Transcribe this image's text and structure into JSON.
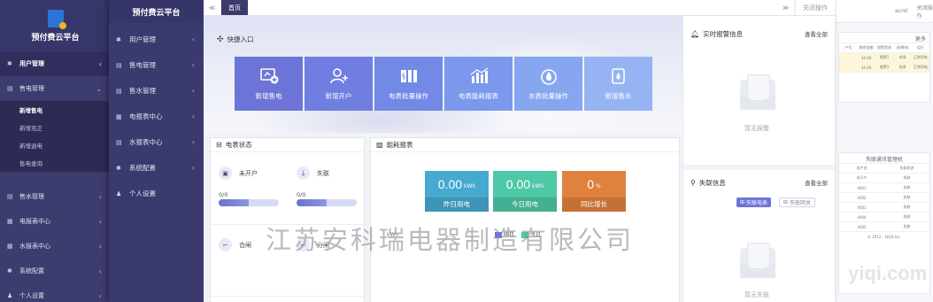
{
  "background_left": {
    "title": "预付费云平台",
    "items": [
      {
        "icon": "gear-icon",
        "label": "用户管理",
        "active": true
      },
      {
        "icon": "list-icon",
        "label": "售电管理"
      },
      {
        "icon": "list-icon",
        "label": "售水管理"
      },
      {
        "icon": "grid-icon",
        "label": "电报表中心"
      },
      {
        "icon": "grid-icon",
        "label": "水报表中心"
      },
      {
        "icon": "gear-icon",
        "label": "系统配置"
      },
      {
        "icon": "user-icon",
        "label": "个人设置"
      }
    ],
    "sub_items": [
      "新增售电",
      "新增充正",
      "新增退电",
      "售电查询"
    ]
  },
  "app": {
    "title": "预付费云平台",
    "nav": [
      {
        "icon": "gear-icon",
        "label": "用户管理"
      },
      {
        "icon": "list-icon",
        "label": "售电管理"
      },
      {
        "icon": "list-icon",
        "label": "售水管理"
      },
      {
        "icon": "grid-icon",
        "label": "电报表中心"
      },
      {
        "icon": "list-icon",
        "label": "水报表中心"
      },
      {
        "icon": "gear-icon",
        "label": "系统配置"
      },
      {
        "icon": "user-icon",
        "label": "个人设置"
      }
    ]
  },
  "tabbar": {
    "back": "≪",
    "tab_home": "首页",
    "forward": "≫",
    "close_ops": "关闭操作"
  },
  "quick_entry": {
    "title": "快捷入口",
    "tiles": [
      {
        "label": "新增售电",
        "icon": "monitor-plus-icon",
        "color": "#6d74d8"
      },
      {
        "label": "新增开户",
        "icon": "user-add-icon",
        "color": "#6f7ee0"
      },
      {
        "label": "电表批量操作",
        "icon": "meter-batch-icon",
        "color": "#7289e6"
      },
      {
        "label": "电表能耗报表",
        "icon": "chart-icon",
        "color": "#7b98ec"
      },
      {
        "label": "水表批量操作",
        "icon": "water-drop-icon",
        "color": "#86a6f0"
      },
      {
        "label": "新增售水",
        "icon": "water-tap-icon",
        "color": "#96b4f4"
      }
    ]
  },
  "meter_status": {
    "title": "电表状态",
    "cells": [
      {
        "icon": "meter-icon",
        "label": "未开户",
        "value": "0/0",
        "progress": 0.5
      },
      {
        "icon": "plug-icon",
        "label": "失联",
        "value": "0/0",
        "progress": 0.5
      },
      {
        "icon": "switch-icon",
        "label": "合闸",
        "value": "",
        "progress": 0
      },
      {
        "icon": "switch-icon",
        "label": "分闸",
        "value": "",
        "progress": 0
      }
    ]
  },
  "energy_report": {
    "title": "能耗报表",
    "kpis": [
      {
        "value": "0.00",
        "unit": "kWh",
        "label": "昨日用电",
        "color": "#46a9cf"
      },
      {
        "value": "0.00",
        "unit": "kWh",
        "label": "今日用电",
        "color": "#4ec8a7"
      },
      {
        "value": "0",
        "unit": "%",
        "label": "同比增长",
        "color": "#e0813e"
      }
    ],
    "unit_label": "kWh",
    "legend": [
      {
        "label": "昨日",
        "color": "#6d74d8"
      },
      {
        "label": "今日",
        "color": "#4ec8a7"
      }
    ]
  },
  "alarms": {
    "title": "实时报警信息",
    "view_all": "查看全部",
    "empty": "暂无报警"
  },
  "offline": {
    "title": "失联信息",
    "view_all": "查看全部",
    "btn_meter": "失联电表",
    "btn_gateway": "失联网关",
    "empty": "暂无失联"
  },
  "background_right": {
    "top_labels": [
      "acrel",
      "关闭操作"
    ],
    "panel1_title": "更多",
    "table1_header": [
      "户号",
      "剩余金额",
      "报警状态",
      "闭/断电",
      "运行"
    ],
    "table1_rows": [
      [
        "",
        "34.00",
        "报警1",
        "合闸",
        "正常用电"
      ],
      [
        "",
        "34.00",
        "报警1",
        "合闸",
        "正常用电"
      ]
    ],
    "panel2_title": "失联通讯管理机",
    "table2_header": [
      "用户名",
      "失联状态"
    ],
    "table2_rows": [
      [
        "未开户",
        "失联"
      ],
      [
        "4001",
        "失联"
      ],
      [
        "4002",
        "失联"
      ],
      [
        "4003",
        "失联"
      ],
      [
        "4004",
        "失联"
      ],
      [
        "4005",
        "失联"
      ]
    ],
    "footer": "© 2012 - 2018 Inc."
  },
  "watermark": "江苏安科瑞电器制造有限公司",
  "watermark_logo": "yiqi.com"
}
